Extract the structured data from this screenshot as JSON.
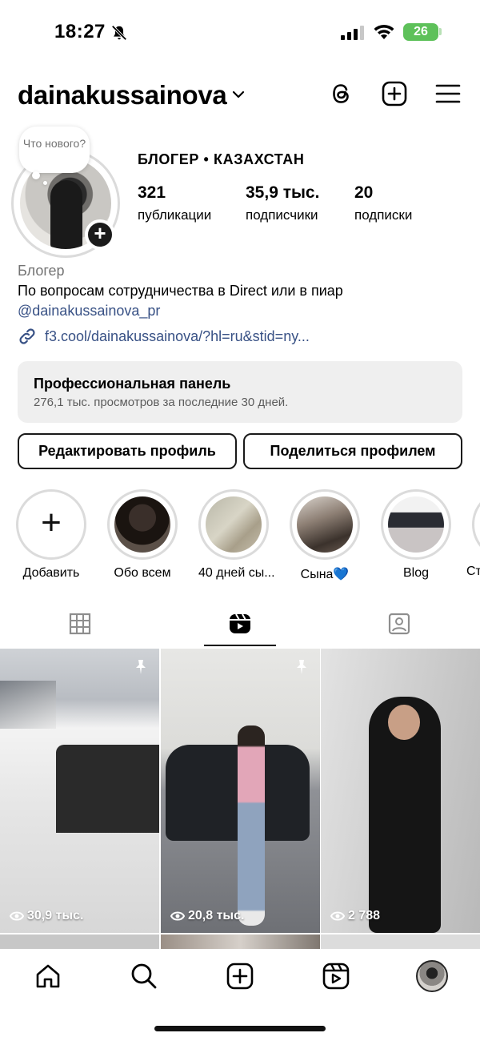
{
  "status_bar": {
    "time": "18:27",
    "battery": "26"
  },
  "header": {
    "username": "dainakussainova"
  },
  "profile": {
    "note": "Что нового?",
    "category_line": "БЛОГЕР • КАЗАХСТАН",
    "stats": [
      {
        "value": "321",
        "label": "публикации"
      },
      {
        "value": "35,9 тыс.",
        "label": "подписчики"
      },
      {
        "value": "20",
        "label": "подписки"
      }
    ],
    "bio_category": "Блогер",
    "bio_text": "По вопросам сотрудничества в Direct или в пиар",
    "bio_mention": "@dainakussainova_pr",
    "bio_link": "f3.cool/dainakussainova/?hl=ru&stid=ny..."
  },
  "pro_panel": {
    "title": "Профессиональная панель",
    "subtitle": "276,1 тыс. просмотров за последние 30 дней."
  },
  "buttons": {
    "edit": "Редактировать профиль",
    "share": "Поделиться профилем"
  },
  "stories": [
    {
      "label": "Добавить"
    },
    {
      "label": "Обо всем"
    },
    {
      "label": "40 дней сы..."
    },
    {
      "label": "Сына💙"
    },
    {
      "label": "Blog"
    },
    {
      "label": "Ст"
    }
  ],
  "reels": [
    {
      "views": "30,9 тыс.",
      "pinned": true
    },
    {
      "views": "20,8 тыс.",
      "pinned": true
    },
    {
      "views": "2 788",
      "pinned": false
    }
  ],
  "colors": {
    "link": "#385185",
    "panel_bg": "#efefef",
    "battery": "#5ec15a"
  }
}
